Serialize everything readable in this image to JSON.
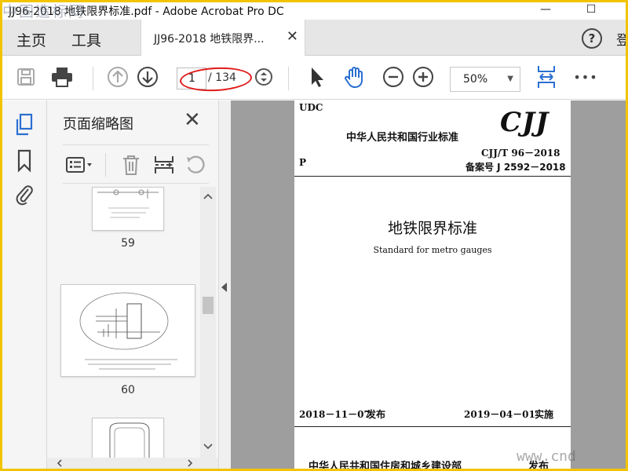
{
  "window": {
    "title": "JJ96-2018 地铁限界标准.pdf - Adobe Acrobat Pro DC",
    "watermark_top": "中国造标网",
    "minimize": "—",
    "maximize": "☐"
  },
  "tabs": {
    "home": "主页",
    "tools": "工具",
    "document": "JJ96-2018 地铁限界...",
    "close": "✕",
    "help": "?",
    "signin_partial": "登"
  },
  "toolbar": {
    "current_page": "1",
    "total_pages": "/ 134",
    "zoom": "50%",
    "more": "•••"
  },
  "thumbnails": {
    "title": "页面缩略图",
    "close": "✕",
    "pages": [
      {
        "number": "59"
      },
      {
        "number": "60"
      }
    ]
  },
  "document": {
    "udc": "UDC",
    "header": "中华人民共和国行业标准",
    "logo": "CJJ",
    "p": "P",
    "code": "CJJ/T 96－2018",
    "filing": "备案号 J 2592－2018",
    "title_cn": "地铁限界标准",
    "title_en": "Standard for metro gauges",
    "issue_date": "2018－11－07",
    "issue_label": "发布",
    "impl_date": "2019－04－01",
    "impl_label": "实施",
    "publisher": "中华人民共和国住房和城乡建设部",
    "publish_word": "发布"
  },
  "watermark_bottom": "www.cnd",
  "colors": {
    "frame": "#f2c400",
    "accent_blue": "#2b6fd1",
    "annotation_red": "#e11b1b",
    "doc_background": "#9e9e9e"
  },
  "icons": [
    "save-icon",
    "print-icon",
    "prev-page-icon",
    "next-page-icon",
    "page-nav-icon",
    "select-arrow-icon",
    "hand-icon",
    "zoom-out-icon",
    "zoom-in-icon",
    "fit-page-icon",
    "more-icon",
    "thumbnails-icon",
    "bookmark-icon",
    "attachment-icon",
    "options-icon",
    "delete-icon",
    "insert-icon",
    "rotate-icon"
  ]
}
